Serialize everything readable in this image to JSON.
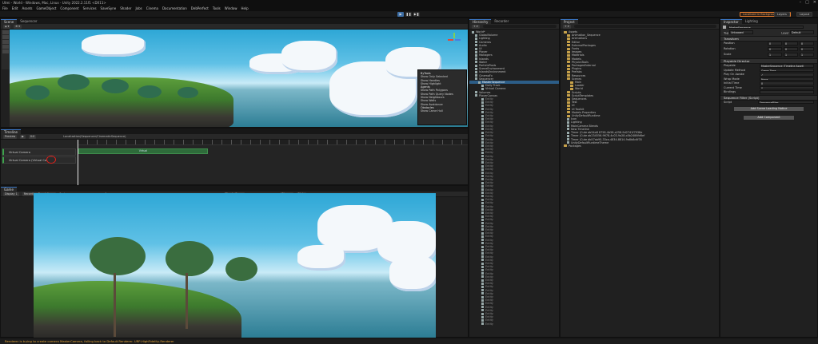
{
  "window": {
    "title": "Utmi - World - Windows, Mac, Linux - Unity 2022.2.11f1 <DX11>",
    "controls": [
      "–",
      "□",
      "✕"
    ]
  },
  "menu": [
    "File",
    "Edit",
    "Assets",
    "GameObject",
    "Component",
    "Services",
    "SaveSyne",
    "Shader",
    "Jobs",
    "Cinema",
    "Documentation",
    "DebPerfect",
    "Tools",
    "Window",
    "Help"
  ],
  "toolbar": {
    "play": "▶",
    "pause": "❚❚",
    "step": "▶❚",
    "warning": "Localized in Background ▾ Unm",
    "layers": "Layers",
    "layout": "Layout"
  },
  "scene": {
    "tabs": [
      "Scene",
      "Sequencer"
    ],
    "context_menu": {
      "section1": "ByTools",
      "items1": [
        "Show Only Selected",
        "Show Handles",
        "Show Highlight"
      ],
      "section2": "Agents",
      "items2": [
        "Show Path Polygons",
        "Show Path Query Nodes",
        "Show Neighbours",
        "Show Walls",
        "Show Avoidance"
      ],
      "section3": "Obstacles",
      "items3": [
        "Show Carve Hull"
      ]
    }
  },
  "timeline": {
    "tab": "Timeline",
    "preview": "Preview",
    "time": "0:0",
    "sequence": "Localization(Sequencer/CinematicSequence)",
    "tracks": [
      {
        "label": "Virtual Camera"
      },
      {
        "label": "Virtual Camera (Virtual Ca"
      }
    ],
    "clip_label": "Virtual"
  },
  "game": {
    "tab": "Game",
    "display": "Display 1",
    "resolution": "Recording Resolution ▾",
    "scale": "Scale",
    "scale_value": "1x",
    "play_mode": "Play In Game",
    "options": [
      "Gizmos",
      "Stats"
    ]
  },
  "hierarchy": {
    "tabs": [
      "Hierarchy",
      "Recorder"
    ],
    "items": [
      {
        "label": "World*",
        "indent": 0,
        "selected": false
      },
      {
        "label": "GlobalVolume",
        "indent": 1,
        "selected": false
      },
      {
        "label": "Lighting",
        "indent": 1,
        "selected": false
      },
      {
        "label": "Cameras",
        "indent": 1,
        "selected": false
      },
      {
        "label": "Audio",
        "indent": 1,
        "selected": false
      },
      {
        "label": "UI",
        "indent": 1,
        "selected": false
      },
      {
        "label": "Player",
        "indent": 1,
        "selected": false
      },
      {
        "label": "Managers",
        "indent": 1,
        "selected": false
      },
      {
        "label": "Islands",
        "indent": 1,
        "selected": false
      },
      {
        "label": "Water",
        "indent": 1,
        "selected": false
      },
      {
        "label": "ParticlePools",
        "indent": 1,
        "selected": false
      },
      {
        "label": "SceneEnvironment",
        "indent": 1,
        "selected": false
      },
      {
        "label": "IslandsEnvironment",
        "indent": 1,
        "selected": false
      },
      {
        "label": "CinemaFx",
        "indent": 1,
        "selected": false
      },
      {
        "label": "Sequencer",
        "indent": 1,
        "selected": false
      },
      {
        "label": "MasterSequence",
        "indent": 2,
        "selected": true
      },
      {
        "label": "Dolly Track",
        "indent": 3,
        "selected": false
      },
      {
        "label": "Virtual Camera",
        "indent": 3,
        "selected": false
      },
      {
        "label": "Volumes",
        "indent": 1,
        "selected": false
      },
      {
        "label": "PlayerCanvas",
        "indent": 1,
        "selected": false
      }
    ],
    "repeated_label": "Entity"
  },
  "project": {
    "tab": "Project",
    "folders": [
      "Assets",
      "Animation_Sequence",
      "Animations",
      "Editor",
      "ExternalPackages",
      "Fonts",
      "Images",
      "Materials",
      "Models",
      "PhysicsTools",
      "PackagesExternal",
      "Plugins",
      "Prefabs",
      "Resources",
      "Scenes",
      "Main",
      "Loader",
      "World",
      "Scripts",
      "ScriptTemplates",
      "Sequences",
      "Test",
      "UI",
      "UI Toolkit",
      "Models Properties",
      "UnityDefaultRuntime"
    ],
    "files": [
      "Icon",
      "Lighting",
      "MainCamera Blends",
      "New Timeline",
      "Timer (Cute ab54a8 8758-4b58-a258-9d2741f7938e",
      "Timer (Cute ab234556-9678-4c03-9a28-c8b2486fd6ef",
      "Timer (Cute db57ab95-33ca-4834-8814-9a8b8c6f35",
      "UnityDefaultRuntimeTheme"
    ],
    "packages": "Packages"
  },
  "inspector": {
    "tabs": [
      "Inspector",
      "Lighting"
    ],
    "object_name": "MasterSequence",
    "tag_label": "Tag",
    "tag_value": "Untagged",
    "layer_label": "Layer",
    "layer_value": "Default",
    "transform": {
      "title": "Transform",
      "rows": [
        {
          "label": "Position",
          "x": "0",
          "y": "0",
          "z": "0"
        },
        {
          "label": "Rotation",
          "x": "0",
          "y": "0",
          "z": "0"
        },
        {
          "label": "Scale",
          "x": "1",
          "y": "1",
          "z": "1"
        }
      ]
    },
    "director": {
      "title": "Playable Director",
      "rows": [
        {
          "label": "Playable",
          "value": "MasterSequence (Timeline Asset)"
        },
        {
          "label": "Update Method",
          "value": "Game Time"
        },
        {
          "label": "Play On Awake",
          "value": "✓"
        },
        {
          "label": "Wrap Mode",
          "value": "None"
        },
        {
          "label": "Initial Time",
          "value": "0"
        },
        {
          "label": "Current Time",
          "value": "0"
        },
        {
          "label": "Bindings",
          "value": ""
        }
      ]
    },
    "filter": {
      "title": "Sequence Filter (Script)",
      "script_label": "Script",
      "script_value": "SequenceFilter",
      "button": "Add Scene Loading Notice"
    },
    "add_component": "Add Component"
  },
  "status": {
    "message": "Renderer is trying to create camera MasterCamera, falling back to Default Renderer. URP-HighFidelity-Renderer",
    "color": "#e2a33a"
  }
}
